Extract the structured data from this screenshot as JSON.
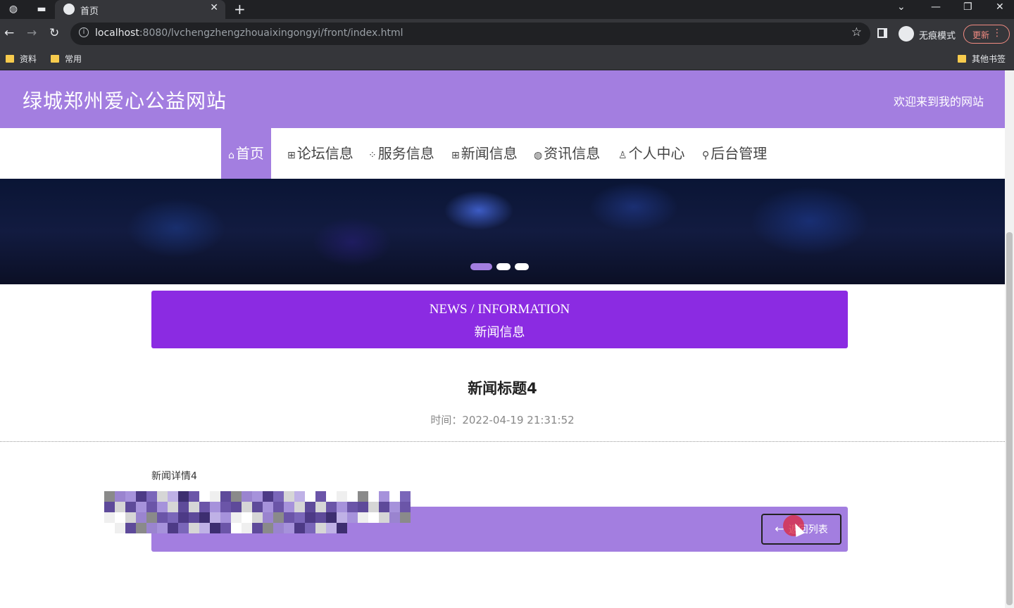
{
  "browser": {
    "tab_title": "首页",
    "url_host": "localhost",
    "url_rest": ":8080/lvchengzhengzhouaixingongyi/front/index.html",
    "incognito_label": "无痕模式",
    "update_label": "更新",
    "bookmarks": [
      "资料",
      "常用"
    ],
    "other_bookmarks": "其他书签"
  },
  "header": {
    "site_title": "绿城郑州爱心公益网站",
    "welcome": "欢迎来到我的网站"
  },
  "nav": [
    {
      "label": "首页",
      "icon": "home-icon",
      "glyph": "⌂"
    },
    {
      "label": "论坛信息",
      "icon": "forum-icon",
      "glyph": "⊞"
    },
    {
      "label": "服务信息",
      "icon": "service-icon",
      "glyph": "⁘"
    },
    {
      "label": "新闻信息",
      "icon": "news-icon",
      "glyph": "⊞"
    },
    {
      "label": "资讯信息",
      "icon": "info-icon",
      "glyph": "◍"
    },
    {
      "label": "个人中心",
      "icon": "user-icon",
      "glyph": "♙"
    },
    {
      "label": "后台管理",
      "icon": "link-icon",
      "glyph": "⚲"
    }
  ],
  "section": {
    "title_en": "NEWS / INFORMATION",
    "title_cn": "新闻信息"
  },
  "article": {
    "title": "新闻标题4",
    "time": "时间：2022-04-19 21:31:52",
    "body": "新闻详情4"
  },
  "actions": {
    "back_label": "返回列表"
  },
  "colors": {
    "accent": "#a37ee0",
    "section_bar": "#8b2be2"
  }
}
